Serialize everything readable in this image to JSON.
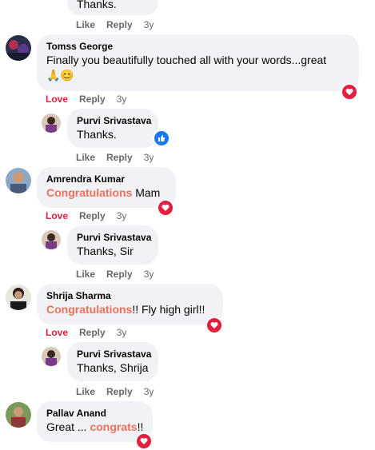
{
  "top": {
    "text": "Thanks.",
    "like": "Like",
    "reply": "Reply",
    "time": "3y"
  },
  "comments": [
    {
      "name": "Tomss George",
      "text": "Finally you beautifully touched all with your words...great",
      "emoji": "🙏😊",
      "love": "Love",
      "reply": "Reply",
      "time": "3y"
    },
    {
      "name": "Purvi Srivastava",
      "text": "Thanks.",
      "like": "Like",
      "reply": "Reply",
      "time": "3y"
    },
    {
      "name": "Amrendra Kumar",
      "highlight": "Congratulations",
      "text": " Mam",
      "love": "Love",
      "reply": "Reply",
      "time": "3y"
    },
    {
      "name": "Purvi Srivastava",
      "text": "Thanks, Sir",
      "like": "Like",
      "reply": "Reply",
      "time": "3y"
    },
    {
      "name": "Shrija Sharma",
      "highlight": "Congratulations",
      "text": "!! Fly high girl!!",
      "love": "Love",
      "reply": "Reply",
      "time": "3y"
    },
    {
      "name": "Purvi Srivastava",
      "text": "Thanks, Shrija",
      "like": "Like",
      "reply": "Reply",
      "time": "3y"
    },
    {
      "name": "Pallav Anand",
      "prefix": "Great ... ",
      "highlight": "congrats",
      "text": "!!"
    }
  ],
  "icons": {
    "heart_reaction": "heart-reaction-icon",
    "like_reaction": "like-reaction-icon"
  },
  "colors": {
    "highlight": "#f2705a",
    "love": "#e41e3f",
    "like": "#1877f2",
    "bubble": "#f0f2f5"
  }
}
